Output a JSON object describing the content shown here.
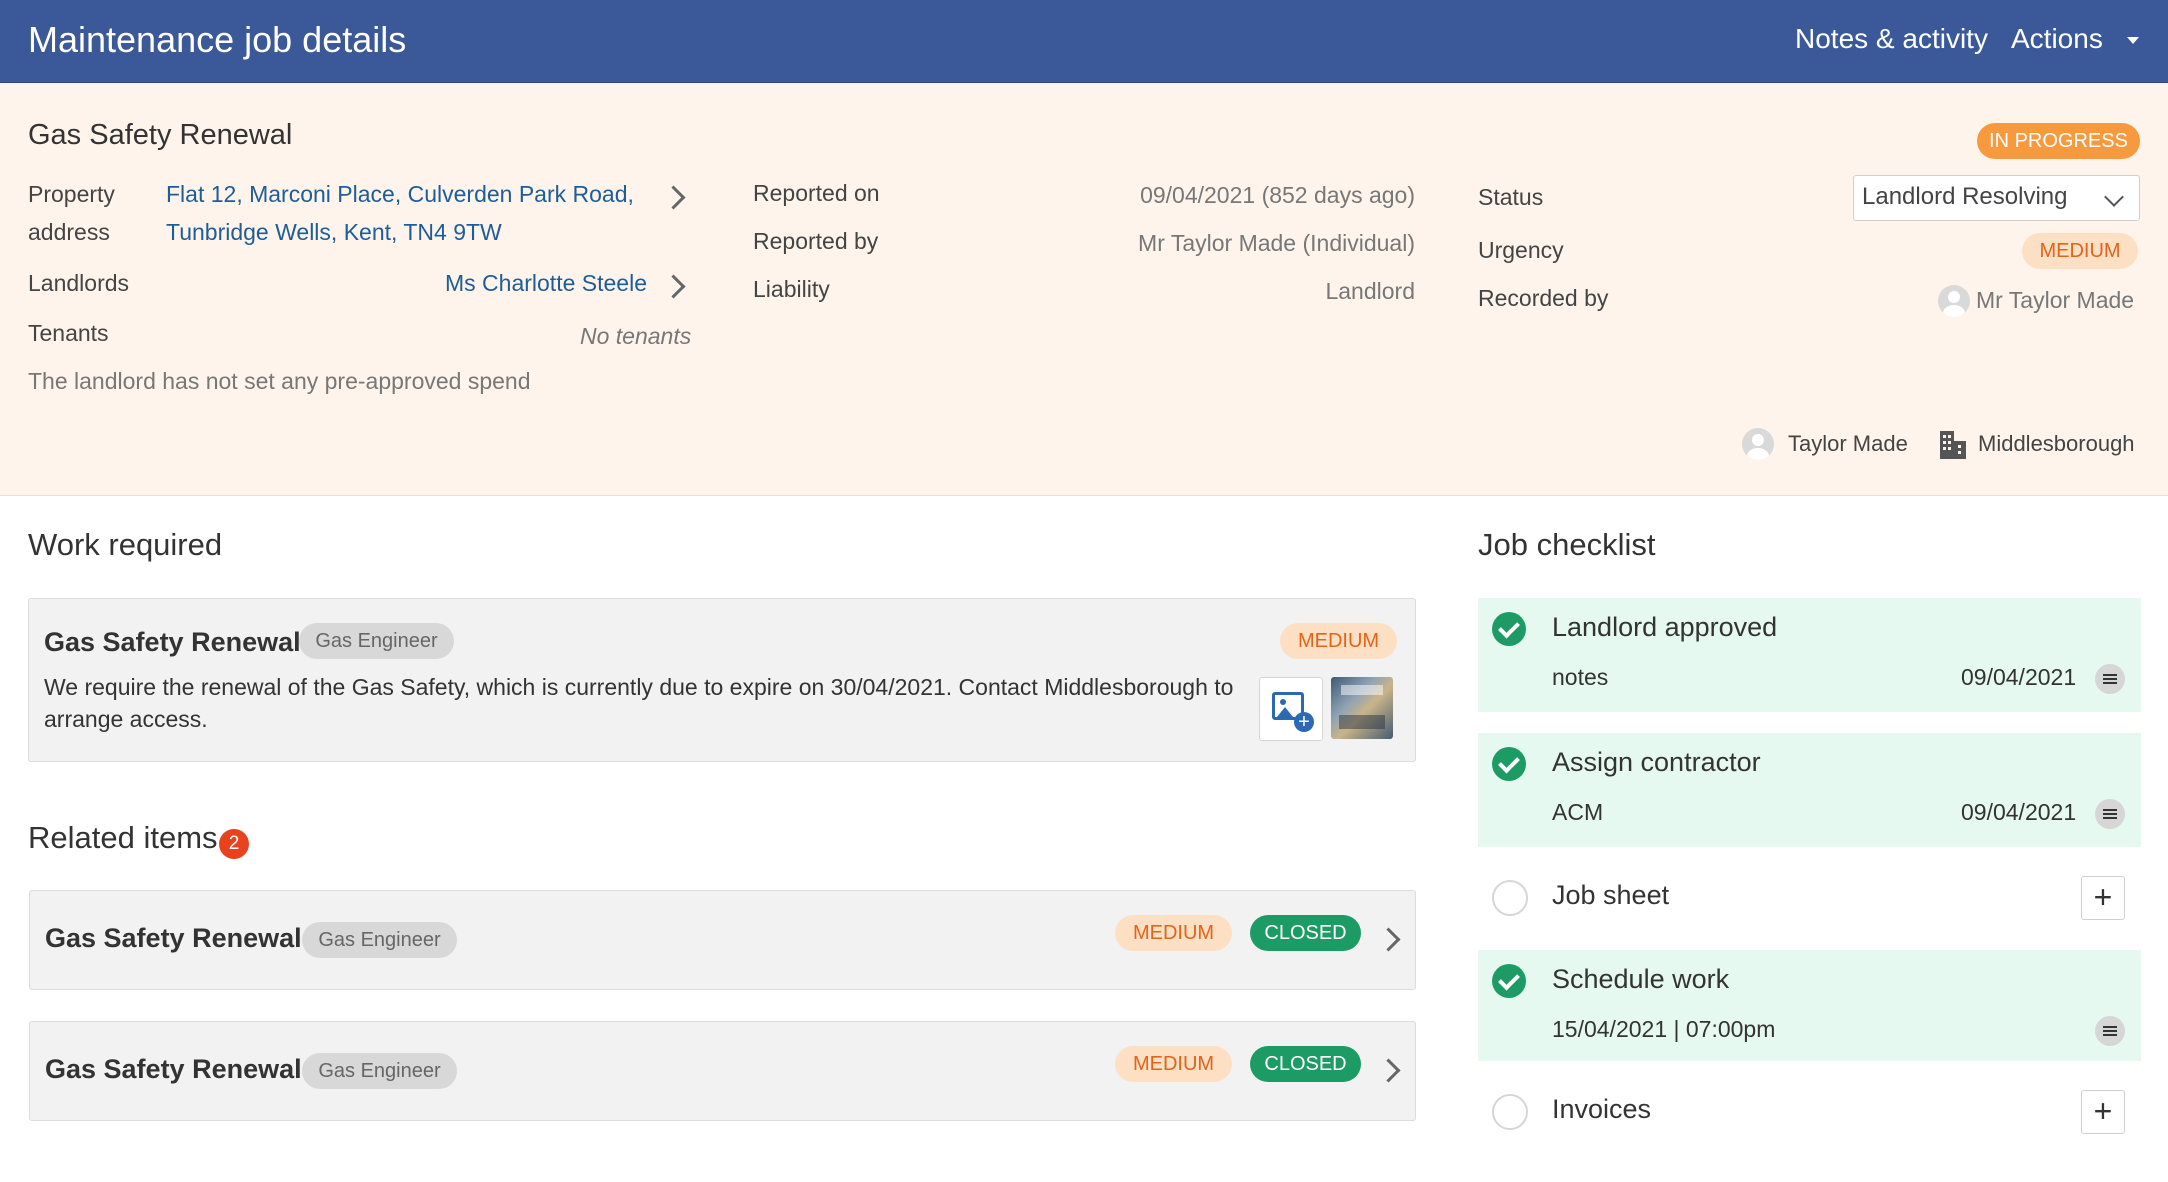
{
  "header": {
    "title": "Maintenance job details",
    "notes_label": "Notes & activity",
    "actions_label": "Actions"
  },
  "job": {
    "title": "Gas Safety Renewal",
    "status_badge": "IN PROGRESS",
    "property_label": "Property\naddress",
    "property_address_line1": "Flat 12, Marconi Place, Culverden Park Road,",
    "property_address_line2": "Tunbridge Wells, Kent, TN4 9TW",
    "landlords_label": "Landlords",
    "landlord_name": "Ms Charlotte Steele",
    "tenants_label": "Tenants",
    "tenants_value": "No tenants",
    "preapproved_text": "The landlord has not set any pre-approved spend",
    "reported_on_label": "Reported on",
    "reported_on_value": "09/04/2021 (852 days ago)",
    "reported_by_label": "Reported by",
    "reported_by_value": "Mr Taylor Made (Individual)",
    "liability_label": "Liability",
    "liability_value": "Landlord",
    "status_label": "Status",
    "status_value": "Landlord Resolving",
    "urgency_label": "Urgency",
    "urgency_value": "MEDIUM",
    "recorded_by_label": "Recorded by",
    "recorded_by_value": "Mr Taylor Made",
    "assignee": "Taylor Made",
    "branch": "Middlesborough"
  },
  "work_required": {
    "section_title": "Work required",
    "title": "Gas Safety Renewal",
    "trade": "Gas Engineer",
    "urgency": "MEDIUM",
    "description": "We require the renewal of the Gas Safety, which is currently due to expire on 30/04/2021. Contact Middlesborough to arrange access."
  },
  "related": {
    "section_title": "Related items",
    "count": "2",
    "items": [
      {
        "title": "Gas Safety Renewal",
        "trade": "Gas Engineer",
        "urgency": "MEDIUM",
        "status": "CLOSED"
      },
      {
        "title": "Gas Safety Renewal",
        "trade": "Gas Engineer",
        "urgency": "MEDIUM",
        "status": "CLOSED"
      }
    ]
  },
  "checklist": {
    "section_title": "Job checklist",
    "items": [
      {
        "title": "Landlord approved",
        "detail": "notes",
        "date": "09/04/2021"
      },
      {
        "title": "Assign contractor",
        "detail": "ACM",
        "date": "09/04/2021"
      },
      {
        "title": "Job sheet"
      },
      {
        "title": "Schedule work",
        "detail": "15/04/2021 | 07:00pm"
      },
      {
        "title": "Invoices"
      }
    ]
  },
  "colors": {
    "header_bg": "#3b5998",
    "summary_bg": "#fef4ec",
    "link": "#1f5d99",
    "in_progress": "#f79a3e",
    "medium_bg": "#fde0c4",
    "medium_text": "#e4631b",
    "closed": "#1c9c64",
    "done_row_bg": "#e6f9f1"
  }
}
